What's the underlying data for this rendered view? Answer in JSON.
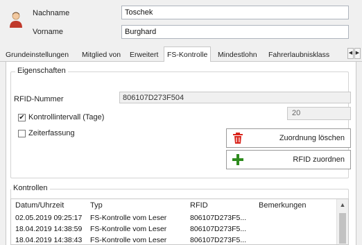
{
  "header": {
    "lastname_label": "Nachname",
    "lastname_value": "Toschek",
    "firstname_label": "Vorname",
    "firstname_value": "Burghard"
  },
  "tabs": [
    {
      "label": "Grundeinstellungen"
    },
    {
      "label": "Mitglied von"
    },
    {
      "label": "Erweitert"
    },
    {
      "label": "FS-Kontrolle",
      "active": true
    },
    {
      "label": "Mindestlohn"
    },
    {
      "label": "Fahrerlaubnisklass"
    }
  ],
  "tab_scroll": {
    "left": "◀",
    "right": "▶"
  },
  "properties": {
    "title": "Eigenschaften",
    "rfid_label": "RFID-Nummer",
    "rfid_value": "806107D273F504",
    "interval_label": "Kontrollintervall (Tage)",
    "interval_checked": true,
    "interval_value": "20",
    "time_label": "Zeiterfassung",
    "time_checked": false,
    "delete_button": "Zuordnung löschen",
    "assign_button": "RFID zuordnen"
  },
  "checks": {
    "on": "✔",
    "off": ""
  },
  "controls": {
    "title": "Kontrollen",
    "columns": [
      "Datum/Uhrzeit",
      "Typ",
      "RFID",
      "Bemerkungen"
    ],
    "rows": [
      [
        "02.05.2019 09:25:17",
        "FS-Kontrolle vom Leser",
        "806107D273F5...",
        ""
      ],
      [
        "18.04.2019 14:38:59",
        "FS-Kontrolle vom Leser",
        "806107D273F5...",
        ""
      ],
      [
        "18.04.2019 14:38:43",
        "FS-Kontrolle vom Leser",
        "806107D273F5...",
        ""
      ]
    ],
    "scroll_up": "▲"
  },
  "colors": {
    "delete_icon": "#d9241b",
    "assign_icon": "#2e8b1e",
    "avatar_skin": "#f2c9a0",
    "avatar_shirt": "#c0392b"
  }
}
